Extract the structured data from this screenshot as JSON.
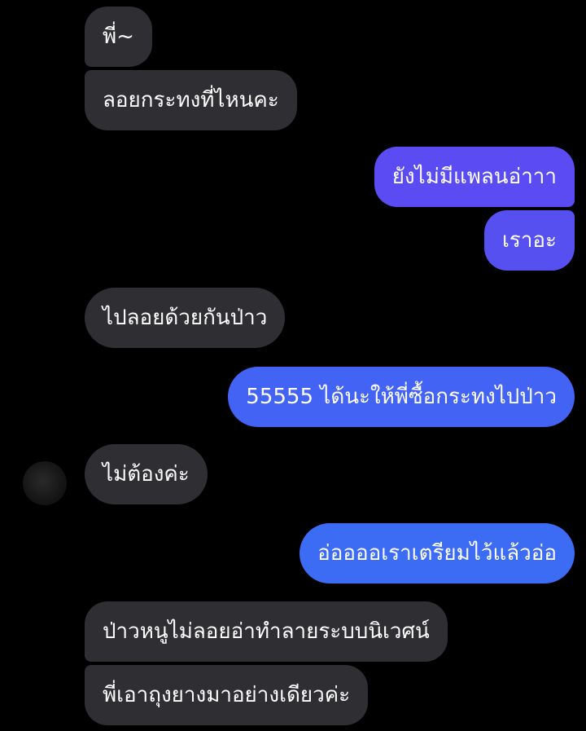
{
  "conversation": {
    "colors": {
      "received_bubble": "#2f2f33",
      "sent_indigo": "#5a4cf2",
      "sent_blue": "#3d6cf4",
      "background": "#000000",
      "text": "#ffffff"
    },
    "avatar_icon": "contact-avatar",
    "messages": [
      {
        "side": "received",
        "text": "พี่~"
      },
      {
        "side": "received",
        "text": "ลอยกระทงที่ไหนคะ"
      },
      {
        "side": "sent",
        "text": "ยังไม่มีแพลนอ่าาา"
      },
      {
        "side": "sent",
        "text": "เราอะ"
      },
      {
        "side": "received",
        "text": "ไปลอยด้วยกันป่าว"
      },
      {
        "side": "sent",
        "text": "55555 ได้นะให้พี่ซื้อกระทงไปป่าว"
      },
      {
        "side": "received",
        "text": "ไม่ต้องค่ะ"
      },
      {
        "side": "sent",
        "text": "อ่ออออเราเตรียมไว้แล้วอ่อ"
      },
      {
        "side": "received",
        "text": "ป่าวหนูไม่ลอยอ่าทำลายระบบนิเวศน์"
      },
      {
        "side": "received",
        "text": "พี่เอาถุงยางมาอย่างเดียวค่ะ"
      }
    ]
  }
}
